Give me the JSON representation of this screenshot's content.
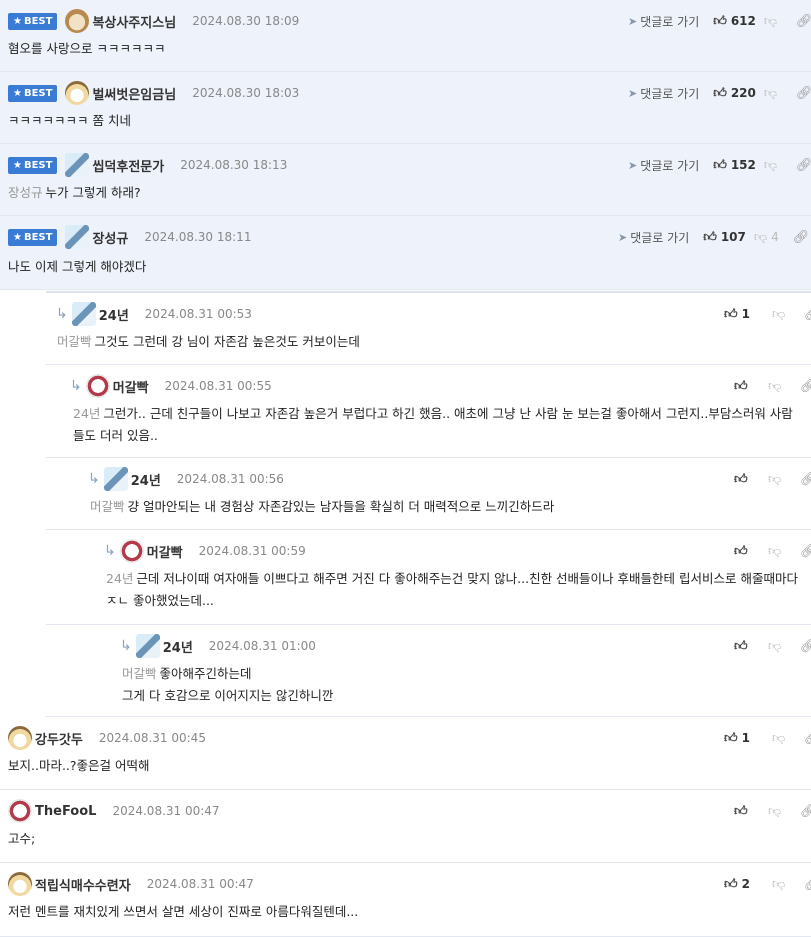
{
  "labels": {
    "best": "BEST",
    "goto": "댓글로 가기"
  },
  "comments": [
    {
      "nick": "복상사주지스님",
      "date": "2024.08.30 18:09",
      "up": "612",
      "down": "",
      "best": true,
      "mention": "",
      "text": "혐오를 사랑으로 ㅋㅋㅋㅋㅋㅋ",
      "avatar": "dog-icon"
    },
    {
      "nick": "벌써벗은임금님",
      "date": "2024.08.30 18:03",
      "up": "220",
      "down": "",
      "best": true,
      "mention": "",
      "text": "ㅋㅋㅋㅋㅋㅋㅋ 쫌 치네",
      "avatar": "fox-icon"
    },
    {
      "nick": "씹덕후전문가",
      "date": "2024.08.30 18:13",
      "up": "152",
      "down": "",
      "best": true,
      "mention": "장성규",
      "text": "누가 그렇게 하래?",
      "avatar": "ice-icon"
    },
    {
      "nick": "장성규",
      "date": "2024.08.30 18:11",
      "up": "107",
      "down": "4",
      "best": true,
      "mention": "",
      "text": "나도 이제 그렇게 해야겠다",
      "avatar": "ice-icon"
    },
    {
      "nick": "24년",
      "date": "2024.08.31 00:53",
      "up": "1",
      "down": "",
      "best": false,
      "mention": "머갈빡",
      "text": "그것도 그런데 강 님이 자존감 높은것도 커보이는데",
      "avatar": "ice-icon"
    },
    {
      "nick": "머갈빡",
      "date": "2024.08.31 00:55",
      "up": "",
      "down": "",
      "best": false,
      "mention": "24년",
      "text": "그런가.. 근데 친구들이 나보고 자존감 높은거 부럽다고 하긴 했음.. 애초에 그냥 난 사람 눈 보는걸 좋아해서 그런지..부담스러워 사람들도 더러 있음..",
      "avatar": "cat-icon"
    },
    {
      "nick": "24년",
      "date": "2024.08.31 00:56",
      "up": "",
      "down": "",
      "best": false,
      "mention": "머갈빡",
      "text": "걍 얼마안되는 내 경험상 자존감있는 남자들을 확실히 더 매력적으로 느끼긴하드라",
      "avatar": "ice-icon"
    },
    {
      "nick": "머갈빡",
      "date": "2024.08.31 00:59",
      "up": "",
      "down": "",
      "best": false,
      "mention": "24년",
      "text": "근데 저나이때 여자애들 이쁘다고 해주면 거진 다 좋아해주는건 맞지 않나...친한 선배들이나 후배들한테 립서비스로 해줄때마다 ㅈㄴ 좋아했었는데...",
      "avatar": "cat-icon"
    },
    {
      "nick": "24년",
      "date": "2024.08.31 01:00",
      "up": "",
      "down": "",
      "best": false,
      "mention": "머갈빡",
      "text": "좋아해주긴하는데",
      "text2": "그게 다 호감으로 이어지지는 않긴하니깐",
      "avatar": "ice-icon"
    },
    {
      "nick": "강두갓두",
      "date": "2024.08.31 00:45",
      "up": "1",
      "down": "",
      "best": false,
      "mention": "",
      "text": "보지..마라..?좋은걸 어떡해",
      "avatar": "fox-icon"
    },
    {
      "nick": "TheFooL",
      "date": "2024.08.31 00:47",
      "up": "",
      "down": "",
      "best": false,
      "mention": "",
      "text": "고수;",
      "avatar": "cat-icon"
    },
    {
      "nick": "적립식매수수련자",
      "date": "2024.08.31 00:47",
      "up": "2",
      "down": "",
      "best": false,
      "mention": "",
      "text": "저런 멘트를 재치있게 쓰면서 살면 세상이 진짜로 아름다워질텐데...",
      "avatar": "fox-icon"
    }
  ]
}
